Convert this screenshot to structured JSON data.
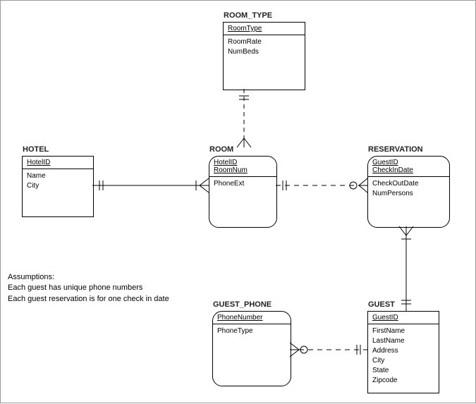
{
  "entities": {
    "room_type": {
      "title": "ROOM_TYPE",
      "pk": [
        "RoomType"
      ],
      "attrs": [
        "RoomRate",
        "NumBeds"
      ]
    },
    "hotel": {
      "title": "HOTEL",
      "pk": [
        "HotelID"
      ],
      "attrs": [
        "Name",
        "City"
      ]
    },
    "room": {
      "title": "ROOM",
      "pk": [
        "HotelID",
        "RoomNum"
      ],
      "attrs": [
        "PhoneExt"
      ]
    },
    "reservation": {
      "title": "RESERVATION",
      "pk": [
        "GuestID",
        "CheckInDate"
      ],
      "attrs": [
        "CheckOutDate",
        "NumPersons"
      ]
    },
    "guest_phone": {
      "title": "GUEST_PHONE",
      "pk": [
        "PhoneNumber"
      ],
      "attrs": [
        "PhoneType"
      ]
    },
    "guest": {
      "title": "GUEST",
      "pk": [
        "GuestID"
      ],
      "attrs": [
        "FirstName",
        "LastName",
        "Address",
        "City",
        "State",
        "Zipcode"
      ]
    }
  },
  "assumptions": {
    "heading": "Assumptions:",
    "lines": [
      "Each guest has unique phone numbers",
      "Each guest reservation is for one check in date"
    ]
  }
}
